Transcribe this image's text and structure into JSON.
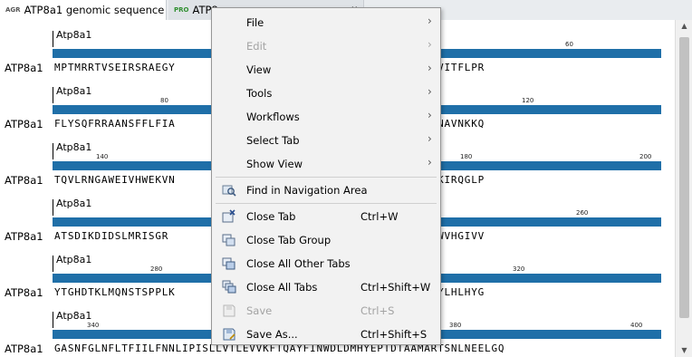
{
  "tabs": [
    {
      "icon": "AGR",
      "label": "ATP8a1 genomic sequence",
      "close": "✕"
    },
    {
      "icon": "PRO",
      "label": "ATP8",
      "close": "✕"
    }
  ],
  "rows": [
    {
      "track": "Atp8a1",
      "label": "ATP8a1",
      "ticks": [
        {
          "n": "60"
        }
      ],
      "sequence": "MPTMRRTVSEIRSRAEGY                      PQLTKFCNNHVSTAKYNVITFLPR"
    },
    {
      "track": "Atp8a1",
      "label": "ATP8a1",
      "ticks": [
        {
          "n": "80"
        },
        {
          "n": "120"
        }
      ],
      "sequence": "FLYSQFRRAANSFFLFIA                      VAAIKEIIEDIKRHKADNAVNKKQ"
    },
    {
      "track": "Atp8a1",
      "label": "ATP8a1",
      "ticks": [
        {
          "n": "140"
        },
        {
          "n": "180"
        },
        {
          "n": "200"
        }
      ],
      "sequence": "TQVLRNGAWEIVHWEKVN                      QAMCYIETSNLDGETNLKIRQGLP"
    },
    {
      "track": "Atp8a1",
      "label": "ATP8a1",
      "ticks": [
        {
          "n": "260"
        }
      ],
      "sequence": "ATSDIKDIDSLMRISGR                       LGADQILLRGAQLRNTQWVHGIVV"
    },
    {
      "track": "Atp8a1",
      "label": "ATP8a1",
      "ticks": [
        {
          "n": "280"
        },
        {
          "n": "320"
        }
      ],
      "sequence": "YTGHDTKLMQNSTSPPLK                      CSVGSAIWNRRHSGKDWYLHLHYG"
    },
    {
      "track": "Atp8a1",
      "label": "ATP8a1",
      "ticks": [
        {
          "n": "340"
        },
        {
          "n": "380"
        },
        {
          "n": "400"
        }
      ],
      "sequence": "GASNFGLNFLTFIILFNNLIPISLLVTLEVVKFTQAYFINWDLDMHYEPTDTAAMARTSNLNEELGQ"
    }
  ],
  "menu": {
    "items": [
      {
        "label": "File",
        "submenu": true
      },
      {
        "label": "Edit",
        "submenu": true,
        "disabled": true
      },
      {
        "label": "View",
        "submenu": true
      },
      {
        "label": "Tools",
        "submenu": true
      },
      {
        "label": "Workflows",
        "submenu": true
      },
      {
        "label": "Select Tab",
        "submenu": true
      },
      {
        "label": "Show View",
        "submenu": true
      },
      {
        "separator": true
      },
      {
        "label": "Find in Navigation Area",
        "icon": "find-in-navigation-icon"
      },
      {
        "separator": true
      },
      {
        "label": "Close Tab",
        "shortcut": "Ctrl+W",
        "icon": "close-tab-icon"
      },
      {
        "label": "Close Tab Group",
        "icon": "close-tab-group-icon"
      },
      {
        "label": "Close All Other Tabs",
        "icon": "close-other-tabs-icon"
      },
      {
        "label": "Close All Tabs",
        "shortcut": "Ctrl+Shift+W",
        "icon": "close-all-tabs-icon"
      },
      {
        "label": "Save",
        "shortcut": "Ctrl+S",
        "icon": "save-icon",
        "disabled": true
      },
      {
        "label": "Save As...",
        "shortcut": "Ctrl+Shift+S",
        "icon": "save-as-icon"
      }
    ]
  },
  "colors": {
    "bar": "#1f6fa8",
    "menu_bg": "#f2f2f2",
    "disabled_text": "#a3a3a3"
  }
}
